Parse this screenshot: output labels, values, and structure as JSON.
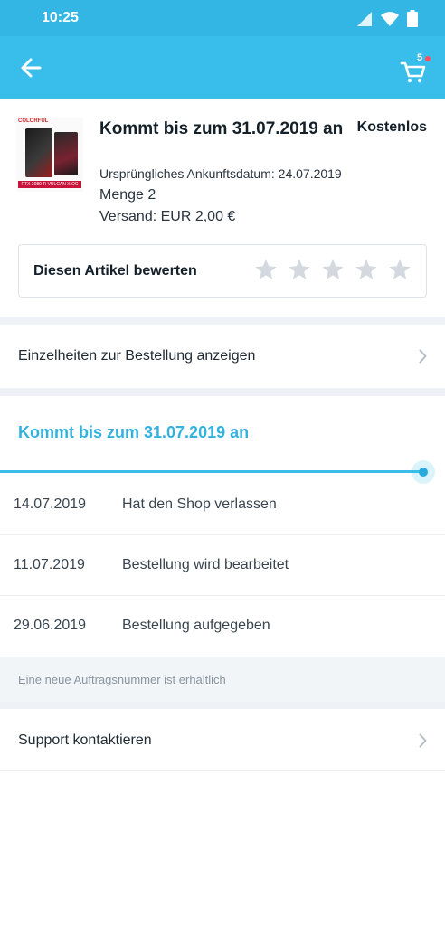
{
  "status": {
    "time": "10:25"
  },
  "header": {
    "cart_count": "5"
  },
  "product": {
    "image_caption": "COLORFUL",
    "image_strip": "RTX 2080 Ti VULCAN X OC",
    "title": "Kommt bis zum 31.07.2019 an",
    "price": "Kostenlos",
    "original_arrival": "Ursprüngliches Ankunftsdatum: 24.07.2019",
    "quantity": "Menge 2",
    "shipping": "Versand: EUR 2,00 €"
  },
  "rating": {
    "label": "Diesen Artikel bewerten",
    "stars": 5,
    "selected": 0
  },
  "order_details": {
    "label": "Einzelheiten zur Bestellung anzeigen"
  },
  "tracking": {
    "title": "Kommt bis zum 31.07.2019 an",
    "events": [
      {
        "date": "14.07.2019",
        "desc": "Hat den Shop verlassen"
      },
      {
        "date": "11.07.2019",
        "desc": "Bestellung wird bearbeitet"
      },
      {
        "date": "29.06.2019",
        "desc": "Bestellung aufgegeben"
      }
    ],
    "notice": "Eine neue Auftragsnummer ist erhältlich"
  },
  "support": {
    "label": "Support kontaktieren"
  },
  "colors": {
    "primary": "#39bdea",
    "accent_text": "#33b2e0",
    "badge": "#ff4f5a"
  }
}
